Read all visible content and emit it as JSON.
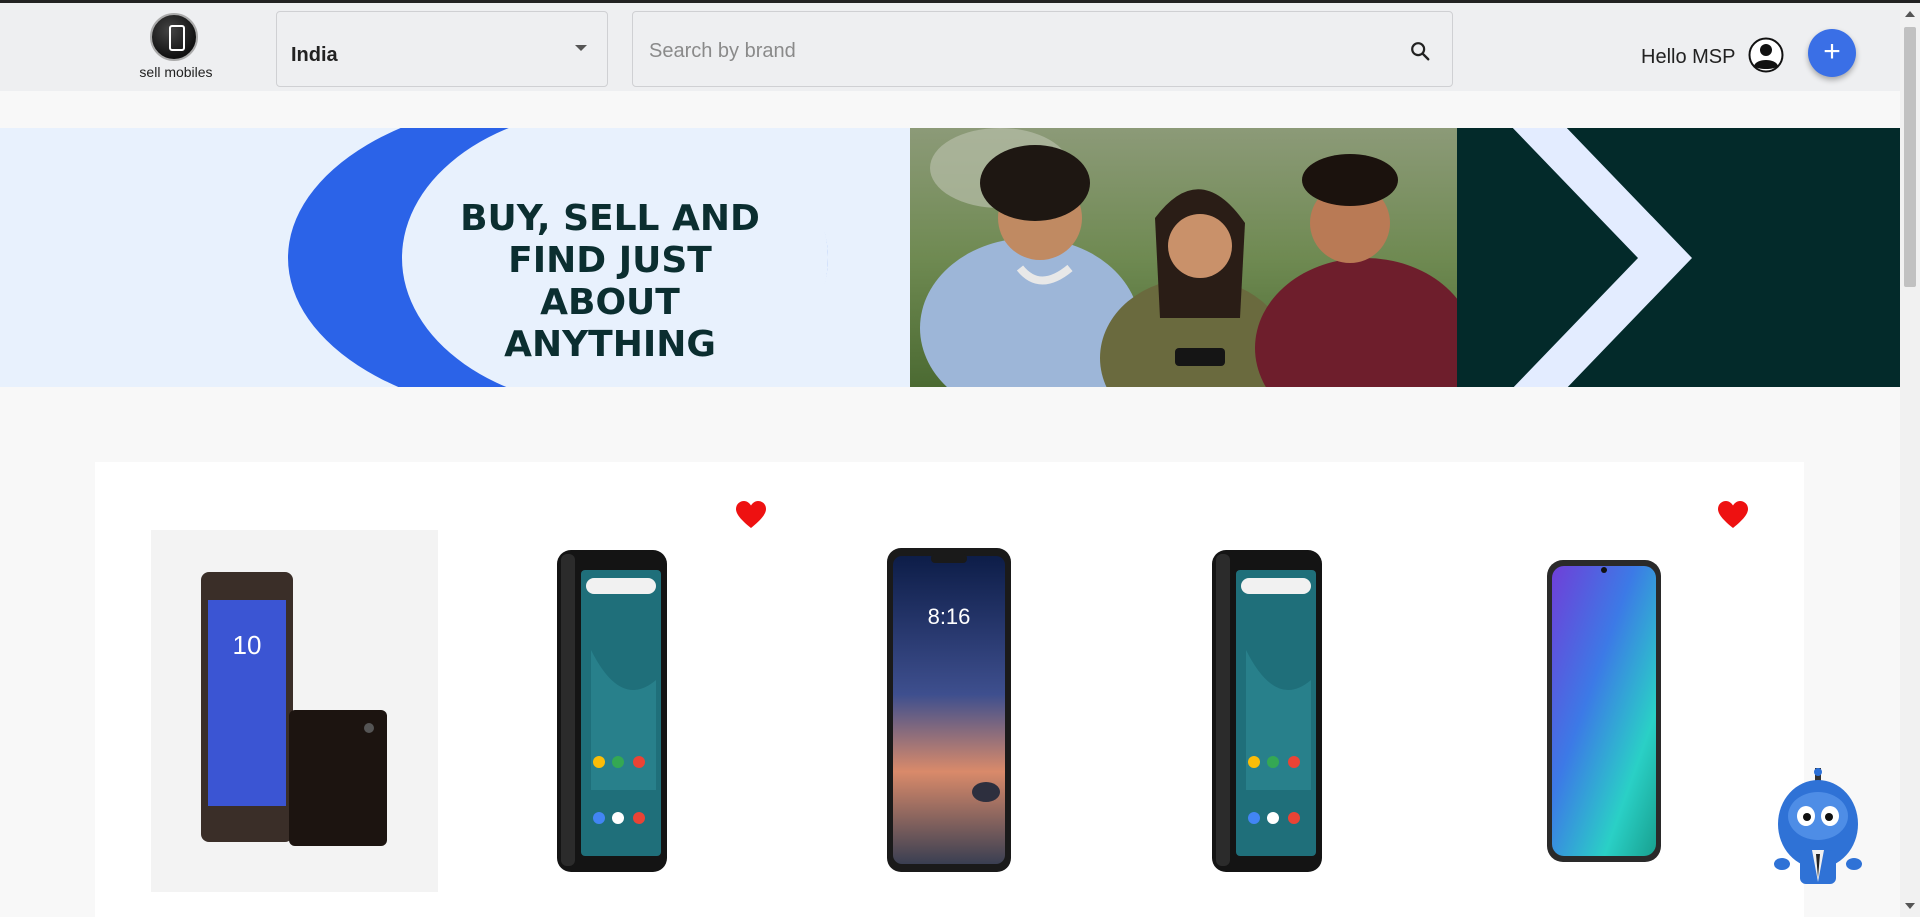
{
  "header": {
    "logo_text": "sell mobiles",
    "country_selected": "India",
    "search_placeholder": "Search by brand",
    "greeting": "Hello MSP",
    "add_label": "+"
  },
  "banner": {
    "tagline_line1": "BUY, SELL AND",
    "tagline_line2": "FIND JUST ABOUT",
    "tagline_line3": "ANYTHING"
  },
  "products": [
    {
      "name": "sony-xperia-phone",
      "favorited": false
    },
    {
      "name": "black-android-phone",
      "favorited": true
    },
    {
      "name": "notch-android-phone",
      "favorited": false
    },
    {
      "name": "black-android-phone",
      "favorited": false
    },
    {
      "name": "blue-gradient-phone",
      "favorited": true
    }
  ],
  "colors": {
    "accent": "#3a6fe6",
    "heart": "#ee1111",
    "banner_dark": "#032a2a",
    "banner_light": "#e8f1fd"
  },
  "icons": {
    "search": "search-icon",
    "user": "user-icon",
    "caret": "caret-down-icon",
    "heart": "heart-icon",
    "bot": "chat-bot-icon"
  }
}
